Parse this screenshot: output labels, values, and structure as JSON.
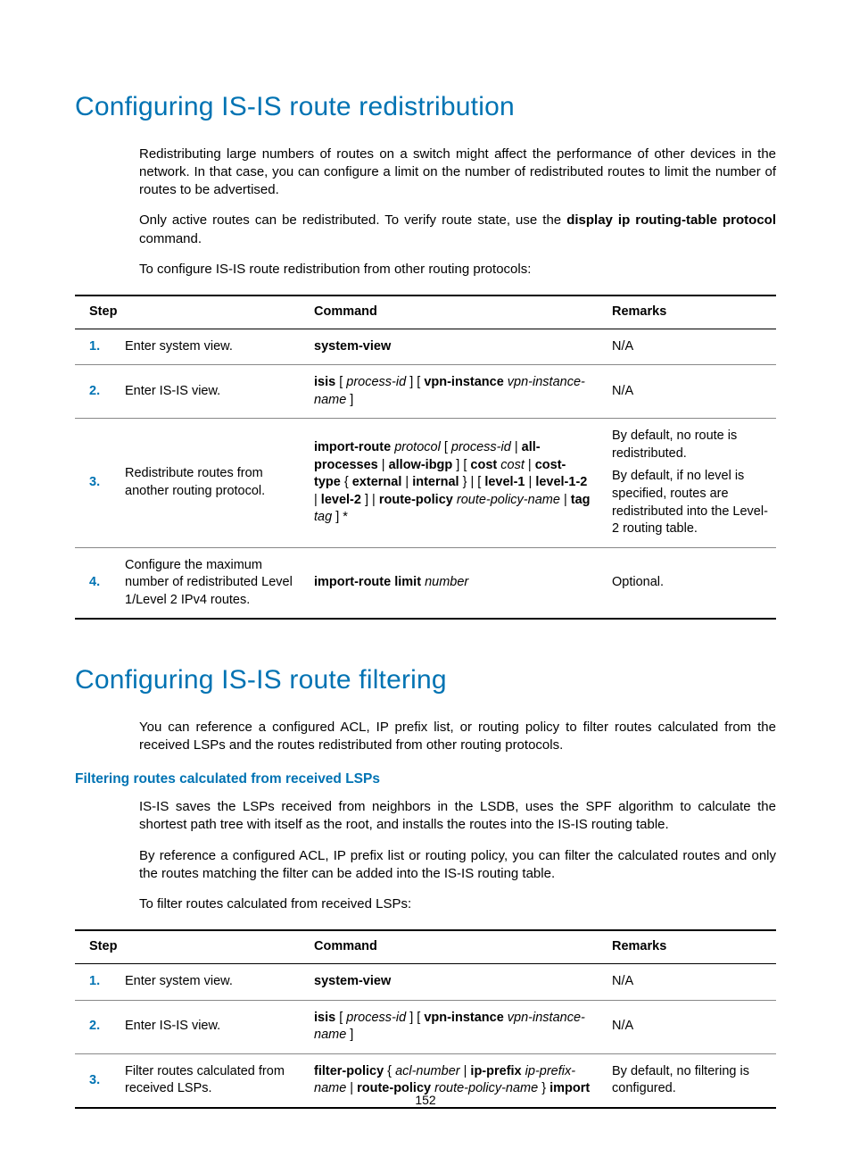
{
  "page_number": "152",
  "section1": {
    "title": "Configuring IS-IS route redistribution",
    "para1": "Redistributing large numbers of routes on a switch might affect the performance of other devices in the network. In that case, you can configure a limit on the number of redistributed routes to limit the number of routes to be advertised.",
    "para2_pre": "Only active routes can be redistributed. To verify route state, use the ",
    "para2_bold": "display ip routing-table protocol",
    "para2_post": " command.",
    "para3": "To configure IS-IS route redistribution from other routing protocols:",
    "table": {
      "headers": {
        "step": "Step",
        "command": "Command",
        "remarks": "Remarks"
      },
      "rows": [
        {
          "num": "1.",
          "step": "Enter system view.",
          "cmd_html": "<span class='b'>system-view</span>",
          "remarks_html": "N/A"
        },
        {
          "num": "2.",
          "step": "Enter IS-IS view.",
          "cmd_html": "<span class='b'>isis</span> [ <span class='i'>process-id</span> ] [ <span class='b'>vpn-instance</span> <span class='i'>vpn-instance-name</span> ]",
          "remarks_html": "N/A"
        },
        {
          "num": "3.",
          "step": "Redistribute routes from another routing protocol.",
          "cmd_html": "<span class='b'>import-route</span> <span class='i'>protocol</span> [ <span class='i'>process-id</span> | <span class='b'>all-processes</span> | <span class='b'>allow-ibgp</span> ] [ <span class='b'>cost</span> <span class='i'>cost</span> | <span class='b'>cost-type</span> { <span class='b'>external</span> | <span class='b'>internal</span> } | [ <span class='b'>level-1</span> | <span class='b'>level-1-2</span> | <span class='b'>level-2</span> ] | <span class='b'>route-policy</span> <span class='i'>route-policy-name</span> | <span class='b'>tag</span> <span class='i'>tag</span> ] *",
          "remarks_html": "<div class='rem-block'><div>By default, no route is redistributed.</div><div>By default, if no level is specified, routes are redistributed into the Level-2 routing table.</div></div>"
        },
        {
          "num": "4.",
          "step": "Configure the maximum number of redistributed Level 1/Level 2 IPv4 routes.",
          "cmd_html": "<span class='b'>import-route limit</span> <span class='i'>number</span>",
          "remarks_html": "Optional."
        }
      ]
    }
  },
  "section2": {
    "title": "Configuring IS-IS route filtering",
    "para1": "You can reference a configured ACL, IP prefix list, or routing policy to filter routes calculated from the received LSPs and the routes redistributed from other routing protocols.",
    "subheading": "Filtering routes calculated from received LSPs",
    "para2": "IS-IS saves the LSPs received from neighbors in the LSDB, uses the SPF algorithm to calculate the shortest path tree with itself as the root, and installs the routes into the IS-IS routing table.",
    "para3": "By reference a configured ACL, IP prefix list or routing policy, you can filter the calculated routes and only the routes matching the filter can be added into the IS-IS routing table.",
    "para4": "To filter routes calculated from received LSPs:",
    "table": {
      "headers": {
        "step": "Step",
        "command": "Command",
        "remarks": "Remarks"
      },
      "rows": [
        {
          "num": "1.",
          "step": "Enter system view.",
          "cmd_html": "<span class='b'>system-view</span>",
          "remarks_html": "N/A"
        },
        {
          "num": "2.",
          "step": "Enter IS-IS view.",
          "cmd_html": "<span class='b'>isis</span> [ <span class='i'>process-id</span> ] [ <span class='b'>vpn-instance</span> <span class='i'>vpn-instance-name</span> ]",
          "remarks_html": "N/A"
        },
        {
          "num": "3.",
          "step": "Filter routes calculated from received LSPs.",
          "cmd_html": "<span class='b'>filter-policy</span> { <span class='i'>acl-number</span> | <span class='b'>ip-prefix</span> <span class='i'>ip-prefix-name</span> | <span class='b'>route-policy</span> <span class='i'>route-policy-name</span> } <span class='b'>import</span>",
          "remarks_html": "By default, no filtering is configured."
        }
      ]
    }
  }
}
